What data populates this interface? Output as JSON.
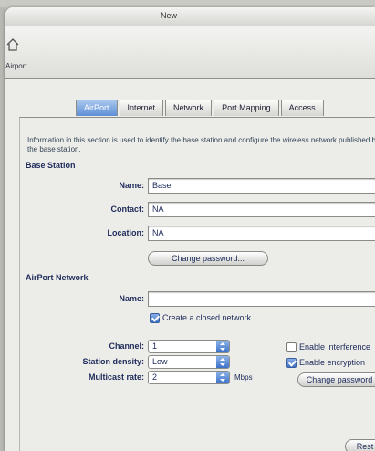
{
  "window": {
    "title": "New"
  },
  "toolbar": {
    "home_label": "Airport",
    "home_icon": "home-icon"
  },
  "tabs": [
    {
      "label": "AirPort",
      "active": true
    },
    {
      "label": "Internet",
      "active": false
    },
    {
      "label": "Network",
      "active": false
    },
    {
      "label": "Port Mapping",
      "active": false
    },
    {
      "label": "Access",
      "active": false
    }
  ],
  "description": "Information in this section is used to identify the base station and configure the wireless network published by the base station.",
  "base_station": {
    "section_label": "Base Station",
    "name_label": "Name:",
    "name_value": "Base",
    "contact_label": "Contact:",
    "contact_value": "NA",
    "location_label": "Location:",
    "location_value": "NA",
    "change_password_label": "Change password..."
  },
  "airport_network": {
    "section_label": "AirPort Network",
    "name_label": "Name:",
    "name_value": "",
    "closed_network_label": "Create a closed network",
    "closed_network_checked": true,
    "channel_label": "Channel:",
    "channel_value": "1",
    "station_density_label": "Station density:",
    "station_density_value": "Low",
    "multicast_rate_label": "Multicast rate:",
    "multicast_rate_value": "2",
    "multicast_unit": "Mbps",
    "interference_label": "Enable interference",
    "interference_checked": false,
    "encryption_label": "Enable encryption",
    "encryption_checked": true,
    "change_password_label": "Change password"
  },
  "footer": {
    "button_label": "Rest"
  },
  "colors": {
    "accent": "#5e8fd6",
    "label_text": "#1d2a5a"
  }
}
